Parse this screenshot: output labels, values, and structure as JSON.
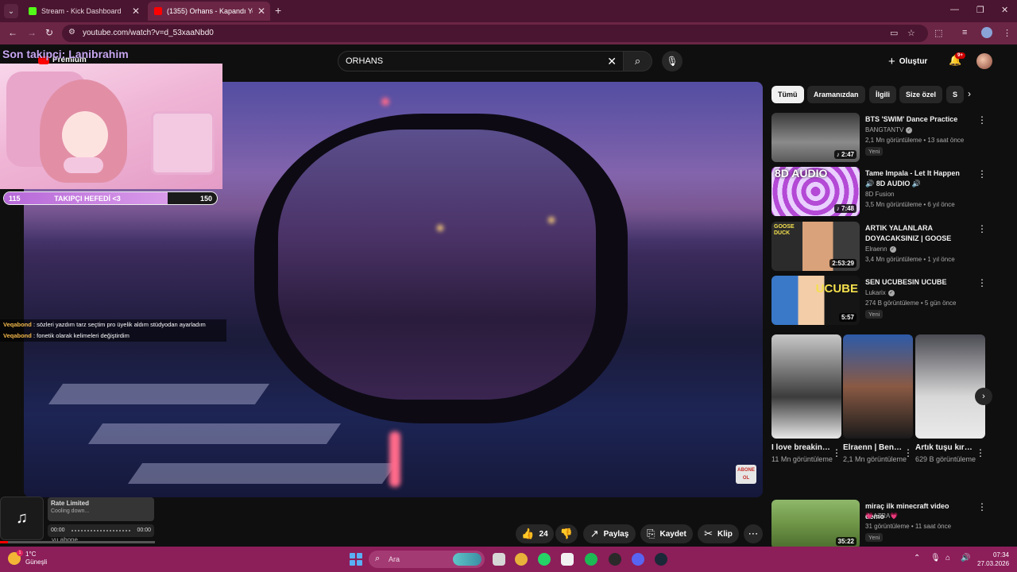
{
  "browser": {
    "tabs": [
      {
        "title": "Stream - Kick Dashboard",
        "active": false
      },
      {
        "title": "(1355) Orhans - Kapandı Yolun",
        "active": true
      }
    ],
    "url": "youtube.com/watch?v=d_53xaaNbd0"
  },
  "youtube": {
    "search_value": "ORHANS",
    "create_label": "Oluştur",
    "notification_count": "9+",
    "logo_text": "Premium"
  },
  "overlay": {
    "follower_title": "Son takipçi: Lanibrahim",
    "follow_goal": {
      "current": "115",
      "label": "TAKIPÇI HEFEDİ <3",
      "target": "150",
      "fraction": 0.77
    }
  },
  "chat": [
    {
      "user": "Veqabond",
      "message": ": sözleri yazdım tarz seçtim pro üyelik aldım stüdyodan ayarladım"
    },
    {
      "user": "Veqabond",
      "message": ": fonetik olarak kelimeleri değiştirdim"
    }
  ],
  "rate_widget": {
    "title": "Rate Limited",
    "subtitle": "Cooling down...",
    "time_start": "00:00",
    "time_end": "00:00",
    "under_text": "yu abone"
  },
  "video_overlay": {
    "subscribe_badge": "ABONE OL"
  },
  "actions": {
    "like_count": "24",
    "share_label": "Paylaş",
    "save_label": "Kaydet",
    "clip_label": "Klip"
  },
  "chips": [
    "Tümü",
    "Aramanızdan",
    "İlgili",
    "Size özel",
    "S"
  ],
  "recommendations": [
    {
      "title": "BTS 'SWIM' Dance Practice",
      "channel": "BANGTANTV",
      "verified": true,
      "meta": "2,1 Mn görüntüleme • 13 saat önce",
      "badge": "Yeni",
      "duration": "♪ 2:47"
    },
    {
      "title": "Tame Impala - Let It Happen 🔊 8D AUDIO 🔊",
      "channel": "8D Fusion",
      "verified": false,
      "meta": "3,5 Mn görüntüleme • 6 yıl önce",
      "badge": "",
      "duration": "♪ 7:48",
      "thumb_text": "8D AUDIO"
    },
    {
      "title": "ARTIK YALANLARA DOYACAKSINIZ | GOOSE GOO...",
      "channel": "Elraenn",
      "verified": true,
      "meta": "3,4 Mn görüntüleme • 1 yıl önce",
      "badge": "",
      "duration": "2:53:29",
      "thumb_text": "GOOSE DUCK"
    },
    {
      "title": "SEN UCUBESIN UCUBE",
      "channel": "Lukarix",
      "verified": true,
      "meta": "274 B görüntüleme • 5 gün önce",
      "badge": "Yeni",
      "duration": "5:57",
      "thumb_text": "UCUBE"
    }
  ],
  "shorts": [
    {
      "title": "I love breaking th...",
      "views": "11 Mn görüntüleme"
    },
    {
      "title": "Elraenn | Bende düet...",
      "views": "2,1 Mn görüntüleme"
    },
    {
      "title": "Artık tuşu kırık değil ...",
      "views": "629 B görüntüleme"
    }
  ],
  "last_rec": {
    "title": "miraç ilk minecraft video demo",
    "channel": "💗AZRA💗",
    "meta": "31 görüntüleme • 11 saat önce",
    "badge": "Yeni",
    "duration": "35:22"
  },
  "taskbar": {
    "weather_temp": "1°C",
    "weather_desc": "Güneşli",
    "weather_badge": "1",
    "search_placeholder": "Ara",
    "time": "07:34",
    "date": "27.03.2026"
  }
}
